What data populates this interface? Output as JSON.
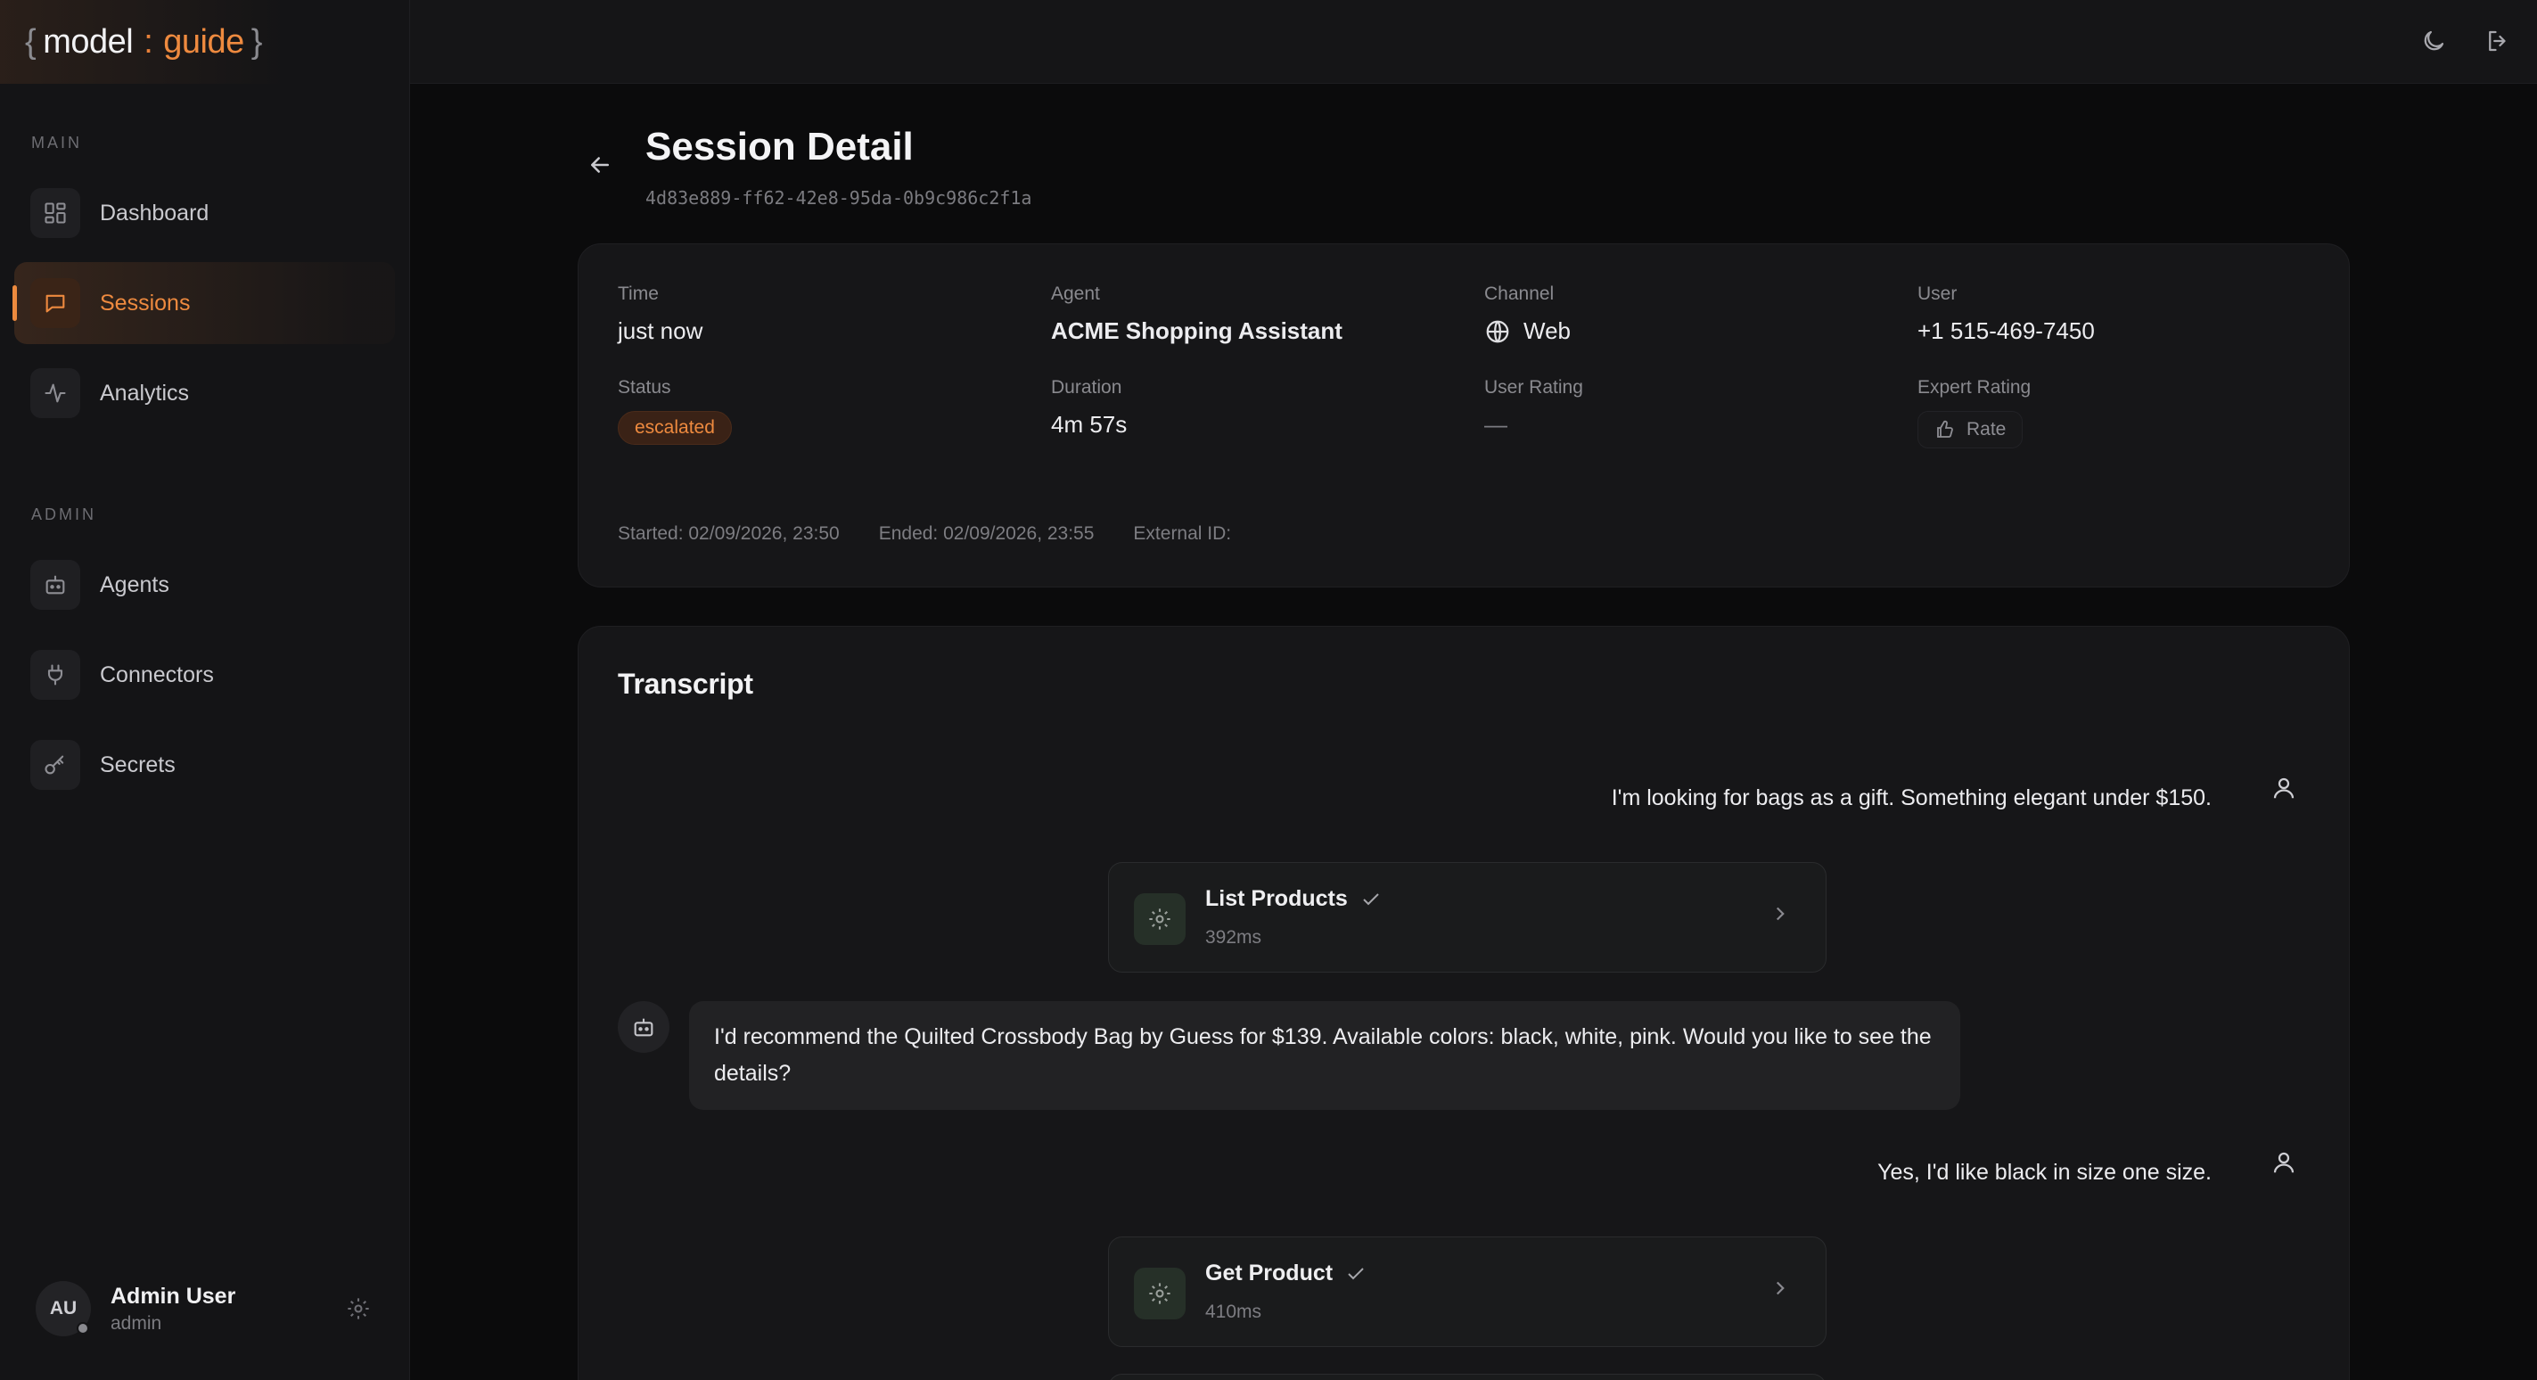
{
  "logo": {
    "word1": "model",
    "separator": ":",
    "word2": "guide"
  },
  "sidebar": {
    "main_heading": "MAIN",
    "main_items": [
      {
        "label": "Dashboard",
        "icon": "grid-icon"
      },
      {
        "label": "Sessions",
        "icon": "chat-icon",
        "active": true
      },
      {
        "label": "Analytics",
        "icon": "pulse-icon"
      }
    ],
    "admin_heading": "ADMIN",
    "admin_items": [
      {
        "label": "Agents",
        "icon": "robot-icon"
      },
      {
        "label": "Connectors",
        "icon": "plug-icon"
      },
      {
        "label": "Secrets",
        "icon": "key-icon"
      }
    ],
    "user": {
      "initials": "AU",
      "name": "Admin User",
      "role": "admin"
    }
  },
  "topbar": {
    "icons": [
      "moon-icon",
      "logout-icon"
    ]
  },
  "page": {
    "title": "Session Detail",
    "session_id": "4d83e889-ff62-42e8-95da-0b9c986c2f1a"
  },
  "info": {
    "time_label": "Time",
    "time_value": "just now",
    "agent_label": "Agent",
    "agent_value": "ACME Shopping Assistant",
    "channel_label": "Channel",
    "channel_value": "Web",
    "user_label": "User",
    "user_value": "+1 515-469-7450",
    "status_label": "Status",
    "status_value": "escalated",
    "duration_label": "Duration",
    "duration_value": "4m 57s",
    "user_rating_label": "User Rating",
    "user_rating_value": "—",
    "expert_rating_label": "Expert Rating",
    "rate_button": "Rate",
    "started": "Started: 02/09/2026, 23:50",
    "ended": "Ended: 02/09/2026, 23:55",
    "external_id": "External ID:",
    "status_color": "#ee8a3f"
  },
  "transcript": {
    "title": "Transcript",
    "messages": [
      {
        "role": "user",
        "text": "I'm looking for bags as a gift. Something elegant under $150."
      },
      {
        "role": "tool",
        "name": "List Products",
        "duration": "392ms"
      },
      {
        "role": "assistant",
        "text": "I'd recommend the Quilted Crossbody Bag by Guess for $139. Available colors: black, white, pink. Would you like to see the details?"
      },
      {
        "role": "user",
        "text": "Yes, I'd like black in size one size."
      },
      {
        "role": "tool",
        "name": "Get Product",
        "duration": "410ms"
      }
    ]
  },
  "colors": {
    "accent": "#ee8a3f",
    "background": "#0b0b0c",
    "card": "#161618"
  }
}
